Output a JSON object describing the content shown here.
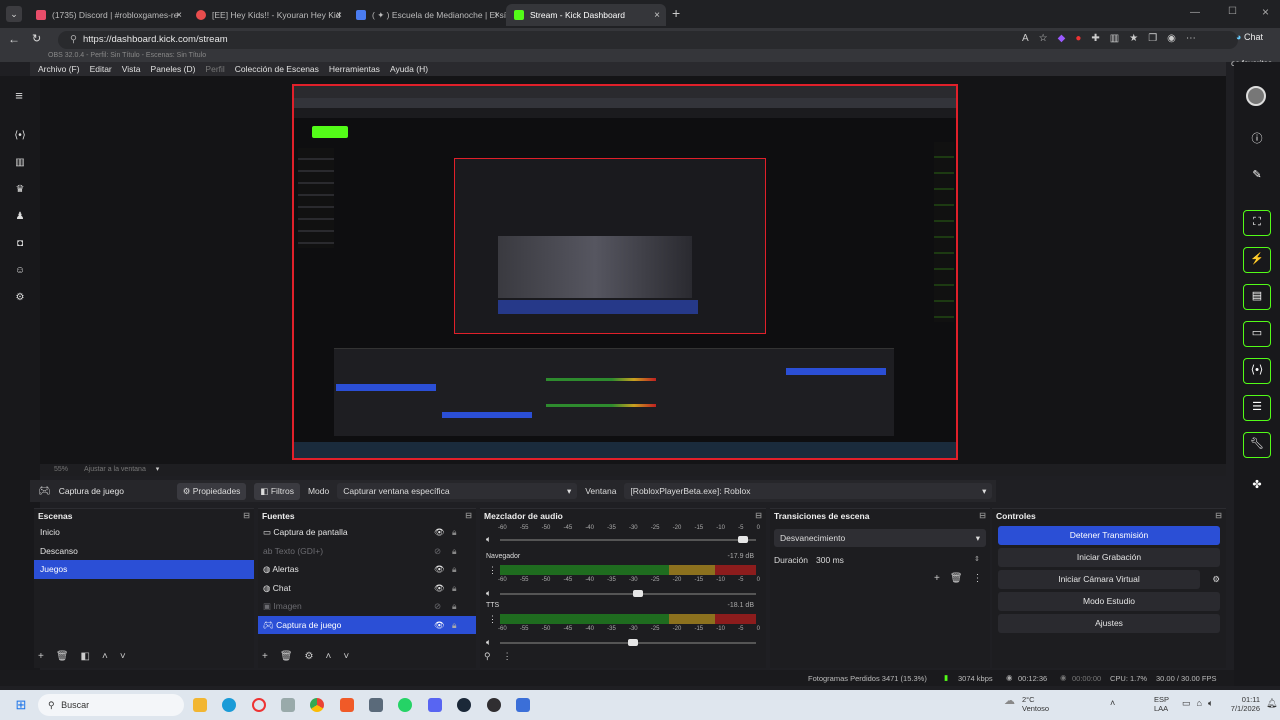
{
  "browser": {
    "tabs": [
      {
        "label": "(1735) Discord | #robloxgames-re",
        "color": "#e84d6a"
      },
      {
        "label": "[EE] Hey Kids!! - Kyouran Hey Kid",
        "color": "#e84d4d"
      },
      {
        "label": "( ✦ ) Escuela de Medianoche | El sí",
        "color": "#4a7cf0"
      },
      {
        "label": "Stream - Kick Dashboard",
        "color": "#53fc18"
      }
    ],
    "new_tab": "+",
    "close": "×",
    "url": "https://dashboard.kick.com/stream",
    "bookmark_hint": "OBS 32.0.4 - Perfil: Sin Título - Escenas: Sin Título",
    "favorites": "os favoritos",
    "chat_label": "Chat"
  },
  "obs": {
    "menu": [
      "Archivo (F)",
      "Editar",
      "Vista",
      "Paneles (D)",
      "Perfil",
      "Colección de Escenas",
      "Herramientas",
      "Ayuda (H)"
    ],
    "zoom_label": "55%",
    "zoom_fit": "Ajustar a la ventana",
    "source_bar": {
      "source_name": "Captura de juego",
      "properties": "Propiedades",
      "filters": "Filtros",
      "mode_label": "Modo",
      "mode_value": "Capturar ventana específica",
      "window_label": "Ventana",
      "window_value": "[RobloxPlayerBeta.exe]: Roblox"
    },
    "scenes": {
      "title": "Escenas",
      "items": [
        "Inicio",
        "Descanso",
        "Juegos"
      ],
      "selected": 2
    },
    "sources": {
      "title": "Fuentes",
      "items": [
        {
          "label": "Captura de pantalla",
          "icon": "monitor-icon",
          "visible": true
        },
        {
          "label": "Texto (GDI+)",
          "icon": "text-icon",
          "visible": false
        },
        {
          "label": "Alertas",
          "icon": "globe-icon",
          "visible": true
        },
        {
          "label": "Chat",
          "icon": "globe-icon",
          "visible": true
        },
        {
          "label": "Imagen",
          "icon": "image-icon",
          "visible": false
        },
        {
          "label": "Captura de juego",
          "icon": "gamepad-icon",
          "visible": true
        }
      ],
      "selected": 5
    },
    "mixer": {
      "title": "Mezclador de audio",
      "ticks": [
        "-60",
        "-55",
        "-50",
        "-45",
        "-40",
        "-35",
        "-30",
        "-25",
        "-20",
        "-15",
        "-10",
        "-5",
        "0"
      ],
      "channels": [
        {
          "name": "",
          "db": "",
          "level": 0.0,
          "volume": 0.97
        },
        {
          "name": "Navegador",
          "db": "-17.9 dB",
          "level": 1.0,
          "volume": 0.52
        },
        {
          "name": "TTS",
          "db": "-18.1 dB",
          "level": 1.0,
          "volume": 0.5
        }
      ]
    },
    "transitions": {
      "title": "Transiciones de escena",
      "value": "Desvanecimiento",
      "duration_label": "Duración",
      "duration_value": "300 ms"
    },
    "controls": {
      "title": "Controles",
      "buttons": [
        "Detener Transmisión",
        "Iniciar Grabación",
        "Iniciar Cámara Virtual",
        "Modo Estudio",
        "Ajustes"
      ]
    },
    "status": {
      "dropped": "Fotogramas Perdidos 3471 (15.3%)",
      "bitrate": "3074 kbps",
      "live_time": "00:12:36",
      "rec_time": "00:00:00",
      "cpu": "CPU: 1.7%",
      "fps": "30.00 / 30.00 FPS"
    }
  },
  "taskbar": {
    "search": "Buscar",
    "weather_temp": "2°C",
    "weather_desc": "Ventoso",
    "lang1": "ESP",
    "lang2": "LAA",
    "time": "01:11",
    "date": "7/1/2026"
  }
}
